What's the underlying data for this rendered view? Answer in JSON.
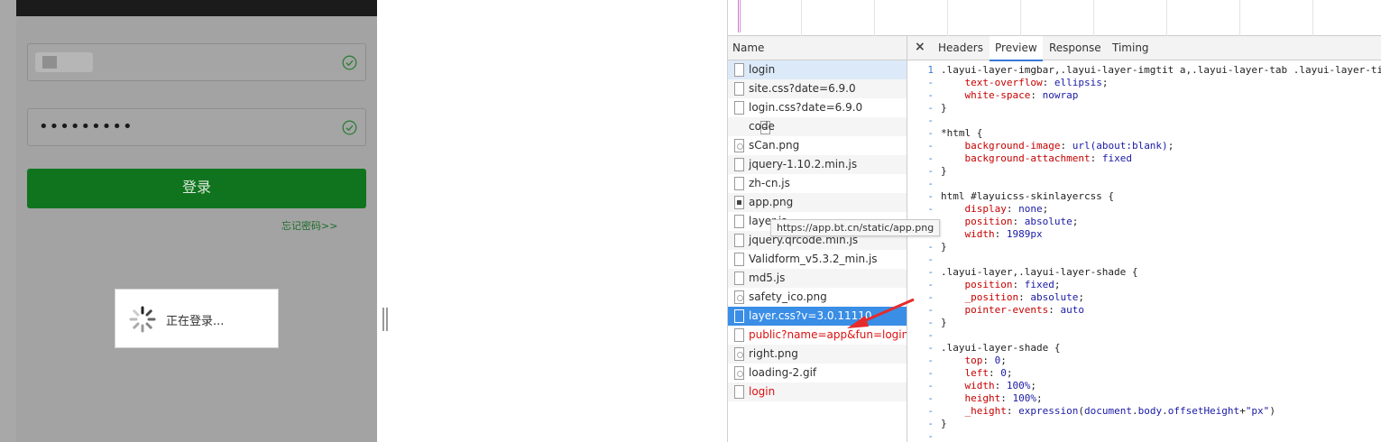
{
  "login_page": {
    "login_button": "登录",
    "forgot_password": "忘记密码>>",
    "password_mask": "•••••••••",
    "loading_text": "正在登录..."
  },
  "devtools": {
    "name_column": "Name",
    "tabs": [
      "Headers",
      "Preview",
      "Response",
      "Timing"
    ],
    "active_tab": "Preview",
    "tooltip": "https://app.bt.cn/static/app.png",
    "files": [
      {
        "name": "login",
        "icon": "doc"
      },
      {
        "name": "site.css?date=6.9.0",
        "icon": "doc"
      },
      {
        "name": "login.css?date=6.9.0",
        "icon": "doc"
      },
      {
        "name": "code",
        "icon": "code"
      },
      {
        "name": "sCan.png",
        "icon": "img"
      },
      {
        "name": "jquery-1.10.2.min.js",
        "icon": "doc"
      },
      {
        "name": "zh-cn.js",
        "icon": "doc"
      },
      {
        "name": "app.png",
        "icon": "imgdark"
      },
      {
        "name": "layer.js",
        "icon": "doc"
      },
      {
        "name": "jquery.qrcode.min.js",
        "icon": "doc"
      },
      {
        "name": "Validform_v5.3.2_min.js",
        "icon": "doc"
      },
      {
        "name": "md5.js",
        "icon": "doc"
      },
      {
        "name": "safety_ico.png",
        "icon": "img"
      },
      {
        "name": "layer.css?v=3.0.11110",
        "icon": "doc"
      },
      {
        "name": "public?name=app&fun=login...",
        "icon": "doc"
      },
      {
        "name": "right.png",
        "icon": "img"
      },
      {
        "name": "loading-2.gif",
        "icon": "img"
      },
      {
        "name": "login",
        "icon": "doc"
      }
    ],
    "selected_index": 13,
    "error_indices": [
      14,
      17
    ],
    "gutter": [
      "1",
      "-",
      "-",
      "-",
      "-",
      "-",
      "-",
      "-",
      "-",
      "-",
      "-",
      "-",
      "-",
      "-",
      "-",
      "-",
      "-",
      "-",
      "-",
      "-",
      "-",
      "-",
      "-",
      "-",
      "-",
      "-",
      "-",
      "-",
      "-",
      "-"
    ],
    "code_lines": [
      [
        [
          "t",
          ".layui-layer-imgbar,.layui-layer-imgtit a,.layui-layer-tab .layui-layer-ti"
        ]
      ],
      [
        [
          "t",
          "    "
        ],
        [
          "p",
          "text-overflow"
        ],
        [
          "t",
          ": "
        ],
        [
          "v",
          "ellipsis"
        ],
        [
          "t",
          ";"
        ]
      ],
      [
        [
          "t",
          "    "
        ],
        [
          "p",
          "white-space"
        ],
        [
          "t",
          ": "
        ],
        [
          "v",
          "nowrap"
        ]
      ],
      [
        [
          "t",
          "}"
        ]
      ],
      [
        [
          "t",
          ""
        ]
      ],
      [
        [
          "t",
          "*html {"
        ]
      ],
      [
        [
          "t",
          "    "
        ],
        [
          "p",
          "background-image"
        ],
        [
          "t",
          ": "
        ],
        [
          "v",
          "url(about:blank)"
        ],
        [
          "t",
          ";"
        ]
      ],
      [
        [
          "t",
          "    "
        ],
        [
          "p",
          "background-attachment"
        ],
        [
          "t",
          ": "
        ],
        [
          "v",
          "fixed"
        ]
      ],
      [
        [
          "t",
          "}"
        ]
      ],
      [
        [
          "t",
          ""
        ]
      ],
      [
        [
          "t",
          "html #layuicss-skinlayercss {"
        ]
      ],
      [
        [
          "t",
          "    "
        ],
        [
          "p",
          "display"
        ],
        [
          "t",
          ": "
        ],
        [
          "v",
          "none"
        ],
        [
          "t",
          ";"
        ]
      ],
      [
        [
          "t",
          "    "
        ],
        [
          "p",
          "position"
        ],
        [
          "t",
          ": "
        ],
        [
          "v",
          "absolute"
        ],
        [
          "t",
          ";"
        ]
      ],
      [
        [
          "t",
          "    "
        ],
        [
          "p",
          "width"
        ],
        [
          "t",
          ": "
        ],
        [
          "v",
          "1989px"
        ]
      ],
      [
        [
          "t",
          "}"
        ]
      ],
      [
        [
          "t",
          ""
        ]
      ],
      [
        [
          "t",
          ".layui-layer,.layui-layer-shade {"
        ]
      ],
      [
        [
          "t",
          "    "
        ],
        [
          "p",
          "position"
        ],
        [
          "t",
          ": "
        ],
        [
          "v",
          "fixed"
        ],
        [
          "t",
          ";"
        ]
      ],
      [
        [
          "t",
          "    "
        ],
        [
          "p",
          "_position"
        ],
        [
          "t",
          ": "
        ],
        [
          "v",
          "absolute"
        ],
        [
          "t",
          ";"
        ]
      ],
      [
        [
          "t",
          "    "
        ],
        [
          "p",
          "pointer-events"
        ],
        [
          "t",
          ": "
        ],
        [
          "v",
          "auto"
        ]
      ],
      [
        [
          "t",
          "}"
        ]
      ],
      [
        [
          "t",
          ""
        ]
      ],
      [
        [
          "t",
          ".layui-layer-shade {"
        ]
      ],
      [
        [
          "t",
          "    "
        ],
        [
          "p",
          "top"
        ],
        [
          "t",
          ": "
        ],
        [
          "v",
          "0"
        ],
        [
          "t",
          ";"
        ]
      ],
      [
        [
          "t",
          "    "
        ],
        [
          "p",
          "left"
        ],
        [
          "t",
          ": "
        ],
        [
          "v",
          "0"
        ],
        [
          "t",
          ";"
        ]
      ],
      [
        [
          "t",
          "    "
        ],
        [
          "p",
          "width"
        ],
        [
          "t",
          ": "
        ],
        [
          "v",
          "100%"
        ],
        [
          "t",
          ";"
        ]
      ],
      [
        [
          "t",
          "    "
        ],
        [
          "p",
          "height"
        ],
        [
          "t",
          ": "
        ],
        [
          "v",
          "100%"
        ],
        [
          "t",
          ";"
        ]
      ],
      [
        [
          "t",
          "    "
        ],
        [
          "p",
          "_height"
        ],
        [
          "t",
          ": "
        ],
        [
          "v",
          "expression"
        ],
        [
          "t",
          "("
        ],
        [
          "v",
          "document"
        ],
        [
          "t",
          "."
        ],
        [
          "v",
          "body"
        ],
        [
          "t",
          "."
        ],
        [
          "v",
          "offsetHeight"
        ],
        [
          "t",
          "+"
        ],
        [
          "v",
          "\"px\""
        ],
        [
          "t",
          ")"
        ]
      ],
      [
        [
          "t",
          "}"
        ]
      ],
      [
        [
          "t",
          ""
        ]
      ]
    ]
  },
  "colors": {
    "login_green": "#10741e",
    "selected_row": "#3a8ee6",
    "error_red": "#d11111",
    "accent_blue": "#3879d9"
  }
}
